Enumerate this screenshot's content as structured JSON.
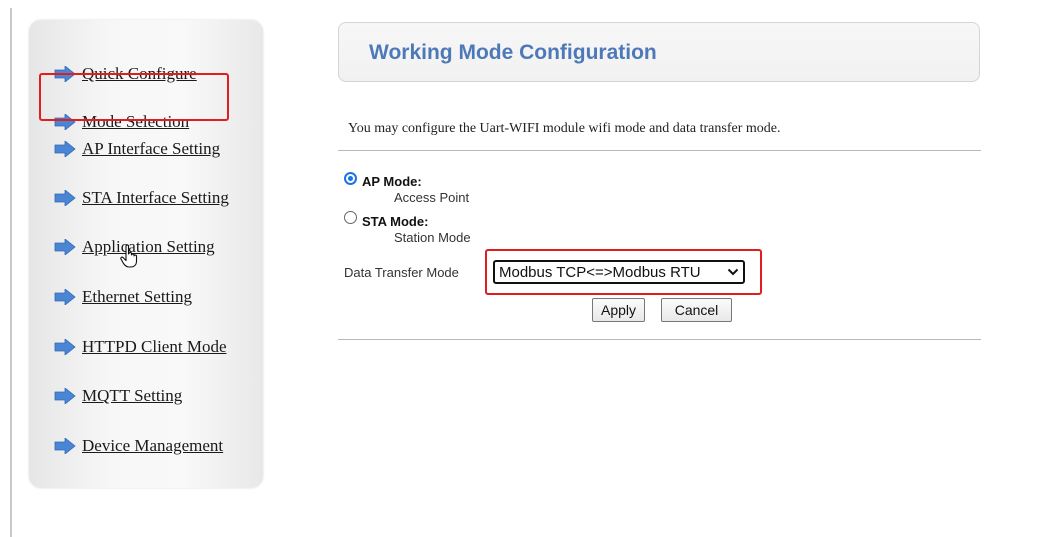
{
  "sidebar": {
    "items": [
      {
        "label": "Quick Configure"
      },
      {
        "label": "Mode Selection"
      },
      {
        "label": "AP Interface Setting"
      },
      {
        "label": "STA Interface Setting"
      },
      {
        "label": "Application Setting"
      },
      {
        "label": "Ethernet Setting"
      },
      {
        "label": "HTTPD Client Mode"
      },
      {
        "label": "MQTT Setting"
      },
      {
        "label": "Device Management"
      }
    ],
    "selected": "Mode Selection"
  },
  "header": {
    "title": "Working Mode Configuration"
  },
  "intro": "You may configure the Uart-WIFI module wifi mode and data transfer mode.",
  "modes": [
    {
      "title": "AP Mode:",
      "subtitle": "Access Point",
      "checked": true
    },
    {
      "title": "STA Mode:",
      "subtitle": "Station Mode",
      "checked": false
    }
  ],
  "data_transfer": {
    "label": "Data Transfer Mode",
    "selected": "Modbus TCP<=>Modbus RTU"
  },
  "buttons": {
    "apply": "Apply",
    "cancel": "Cancel"
  },
  "colors": {
    "accent": "#4d79b8",
    "highlight": "#e31d1d",
    "nav_arrow": "#4a86d4"
  }
}
